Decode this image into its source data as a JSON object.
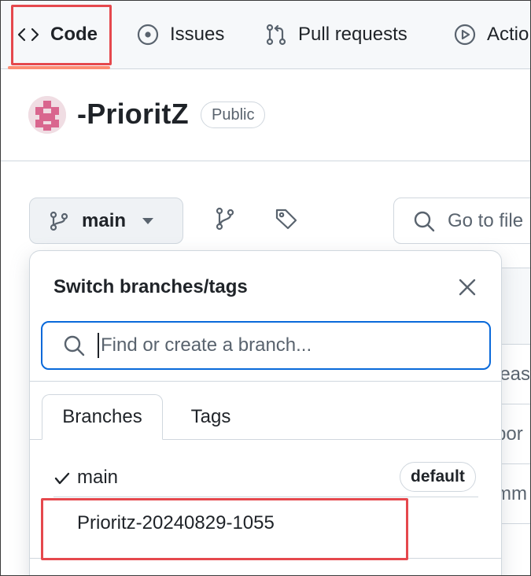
{
  "nav": {
    "code_label": "Code",
    "issues_label": "Issues",
    "pulls_label": "Pull requests",
    "actions_label": "Actio"
  },
  "repo": {
    "name": "-PrioritZ",
    "visibility": "Public"
  },
  "toolbar": {
    "branch_label": "main",
    "goto_placeholder": "Go to file"
  },
  "background_rows": [
    "leas",
    "por",
    "mm"
  ],
  "dropdown": {
    "title": "Switch branches/tags",
    "search_placeholder": "Find or create a branch...",
    "tabs": [
      {
        "label": "Branches",
        "selected": true
      },
      {
        "label": "Tags",
        "selected": false
      }
    ],
    "branches": [
      {
        "name": "main",
        "badge": "default",
        "checked": true
      },
      {
        "name": "Prioritz-20240829-1055",
        "checked": false
      }
    ]
  },
  "colors": {
    "highlight": "#e5484d",
    "focus_border": "#0969da",
    "nav_underline": "#fd8c73"
  }
}
